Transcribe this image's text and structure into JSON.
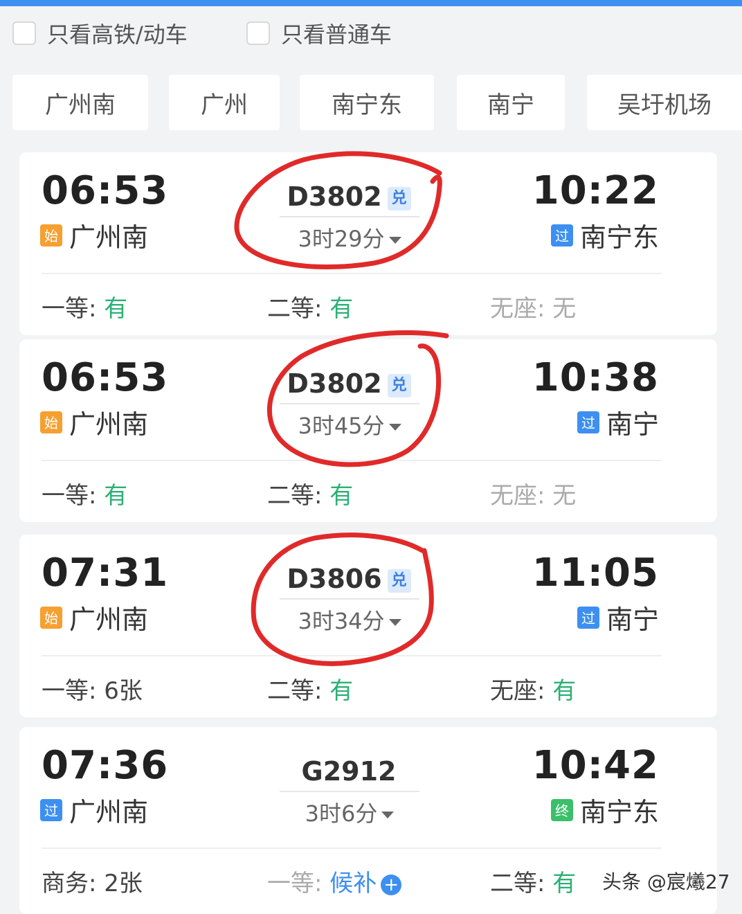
{
  "filters": [
    {
      "label": "只看高铁/动车",
      "checked": false
    },
    {
      "label": "只看普通车",
      "checked": false
    }
  ],
  "stations": [
    "广州南",
    "广州",
    "南宁东",
    "南宁",
    "吴圩机场"
  ],
  "trains": [
    {
      "dep_time": "06:53",
      "dep_badge": "始",
      "dep_station": "广州南",
      "number": "D3802",
      "exchange_badge": "兑",
      "duration": "3时29分",
      "arr_time": "10:22",
      "arr_badge": "过",
      "arr_station": "南宁东",
      "seats": [
        {
          "label": "一等: ",
          "value": "有"
        },
        {
          "label": "二等: ",
          "value": "有"
        },
        {
          "label": "无座: ",
          "value": "无"
        }
      ]
    },
    {
      "dep_time": "06:53",
      "dep_badge": "始",
      "dep_station": "广州南",
      "number": "D3802",
      "exchange_badge": "兑",
      "duration": "3时45分",
      "arr_time": "10:38",
      "arr_badge": "过",
      "arr_station": "南宁",
      "seats": [
        {
          "label": "一等: ",
          "value": "有"
        },
        {
          "label": "二等: ",
          "value": "有"
        },
        {
          "label": "无座: ",
          "value": "无"
        }
      ]
    },
    {
      "dep_time": "07:31",
      "dep_badge": "始",
      "dep_station": "广州南",
      "number": "D3806",
      "exchange_badge": "兑",
      "duration": "3时34分",
      "arr_time": "11:05",
      "arr_badge": "过",
      "arr_station": "南宁",
      "seats": [
        {
          "label": "一等: ",
          "value": "6张"
        },
        {
          "label": "二等: ",
          "value": "有"
        },
        {
          "label": "无座: ",
          "value": "有"
        }
      ]
    },
    {
      "dep_time": "07:36",
      "dep_badge": "过",
      "dep_station": "广州南",
      "number": "G2912",
      "duration": "3时6分",
      "arr_time": "10:42",
      "arr_badge": "终",
      "arr_station": "南宁东",
      "seats": [
        {
          "label": "商务: ",
          "value": "2张"
        },
        {
          "label": "一等: ",
          "value": "候补",
          "plus": "+"
        },
        {
          "label": "二等: ",
          "value": "有"
        }
      ]
    }
  ],
  "watermark": "头条 @宸爔27",
  "colors": {
    "accent": "#3d8ff0",
    "available": "#2bb074",
    "start_badge": "#f5a030",
    "end_badge": "#3bbf6a",
    "annotation": "#e02a2a"
  }
}
